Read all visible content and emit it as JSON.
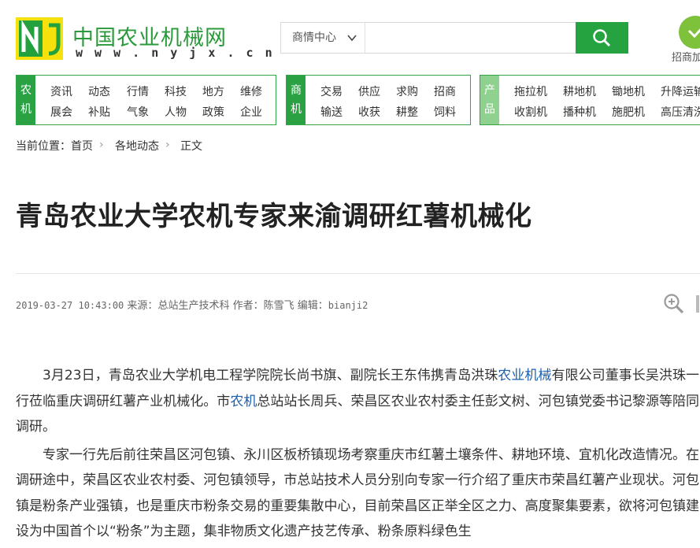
{
  "header": {
    "logo_cn": "中国农业机械网",
    "logo_en": "w w w . n y j x . c n",
    "search": {
      "select_label": "商情中心",
      "placeholder": ""
    },
    "zhaoshang_label": "招商加"
  },
  "nav": {
    "box1": {
      "tag": [
        "农",
        "机"
      ],
      "row1": [
        "资讯",
        "动态",
        "行情",
        "科技",
        "地方",
        "维修"
      ],
      "row2": [
        "展会",
        "补贴",
        "气象",
        "人物",
        "政策",
        "企业"
      ]
    },
    "box2": {
      "tag": [
        "商",
        "机"
      ],
      "row1": [
        "交易",
        "供应",
        "求购",
        "招商"
      ],
      "row2": [
        "输送",
        "收获",
        "耕整",
        "饲料"
      ]
    },
    "box3": {
      "tag": [
        "产",
        "品"
      ],
      "row1": [
        "拖拉机",
        "耕地机",
        "锄地机",
        "升降运输"
      ],
      "row2": [
        "收割机",
        "播种机",
        "施肥机",
        "高压清洗"
      ]
    }
  },
  "breadcrumb": {
    "prefix": "当前位置：",
    "items": [
      "首页",
      "各地动态",
      "正文"
    ]
  },
  "article": {
    "title": "青岛农业大学农机专家来渝调研红薯机械化",
    "datetime": "2019-03-27 10:43:00",
    "source_label": "来源：",
    "source": "总站生产技术科",
    "author_label": "作者：",
    "author": "陈雪飞",
    "editor_label": "编辑：",
    "editor": "bianji2",
    "p1_a": "3月23日，青岛农业大学机电工程学院院长尚书旗、副院长王东伟携青岛洪珠",
    "p1_kw": "农业机械",
    "p1_b": "有限公司董事长吴洪珠一行莅临重庆调研红薯产业机械化。市",
    "p1_kw2": "农机",
    "p1_c": "总站站长周兵、荣昌区农业农村委主任彭文树、河包镇党委书记黎源等陪同调研。",
    "p2": "专家一行先后前往荣昌区河包镇、永川区板桥镇现场考察重庆市红薯土壤条件、耕地环境、宜机化改造情况。在调研途中，荣昌区农业农村委、河包镇领导，市总站技术人员分别向专家一行介绍了重庆市荣昌红薯产业现状。河包镇是粉条产业强镇，也是重庆市粉条交易的重要集散中心，目前荣昌区正举全区之力、高度聚集要素，欲将河包镇建设为中国首个以“粉条”为主题，集非物质文化遗产技艺传承、粉条原料绿色生"
  }
}
